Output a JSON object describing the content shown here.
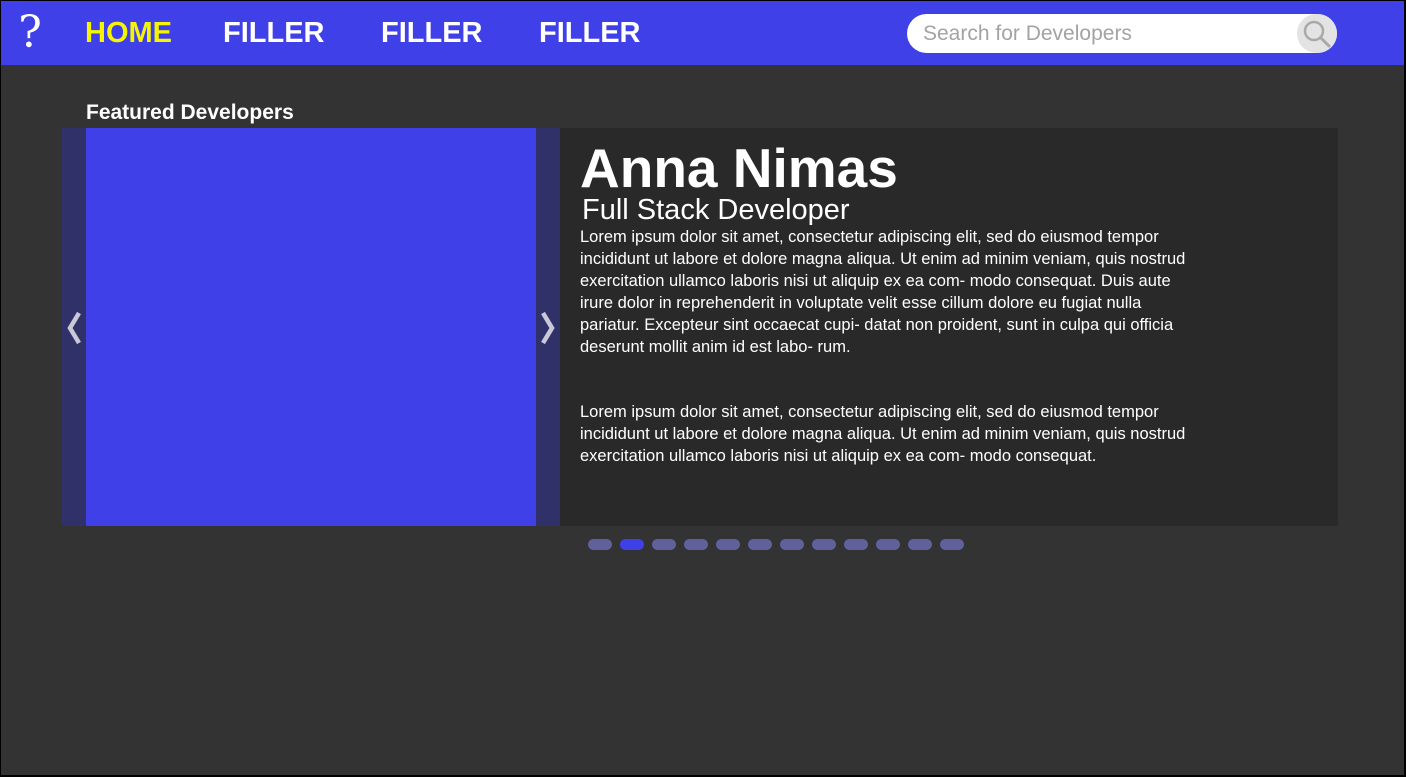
{
  "colors": {
    "brand": "#4040e8",
    "active_nav": "#f5f500",
    "background": "#333333",
    "panel": "#292929",
    "dot_inactive": "#60609a"
  },
  "header": {
    "logo_glyph": "?",
    "nav": [
      {
        "label": "HOME",
        "active": true
      },
      {
        "label": "FILLER",
        "active": false
      },
      {
        "label": "FILLER",
        "active": false
      },
      {
        "label": "FILLER",
        "active": false
      }
    ],
    "search": {
      "placeholder": "Search for Developers",
      "icon": "search-icon"
    }
  },
  "featured": {
    "title": "Featured Developers",
    "prev_icon": "chevron-left-icon",
    "next_icon": "chevron-right-icon",
    "developer": {
      "name": "Anna Nimas",
      "role": "Full Stack Developer",
      "bio": [
        "Lorem ipsum dolor sit amet, consectetur adipiscing elit, sed do eiusmod tempor incididunt ut labore et dolore magna aliqua. Ut enim ad minim veniam, quis nostrud exercitation ullamco laboris nisi ut aliquip ex ea com- modo consequat. Duis aute irure dolor in reprehenderit in voluptate velit esse cillum dolore eu fugiat nulla pariatur. Excepteur sint occaecat cupi- datat non proident, sunt in culpa qui officia deserunt mollit anim id est labo- rum.",
        "Lorem ipsum dolor sit amet, consectetur adipiscing elit, sed do eiusmod tempor incididunt ut labore et dolore magna aliqua. Ut enim ad minim veniam, quis nostrud exercitation ullamco laboris nisi ut aliquip ex ea com- modo consequat."
      ]
    },
    "pagination": {
      "total": 12,
      "active_index": 1
    }
  }
}
